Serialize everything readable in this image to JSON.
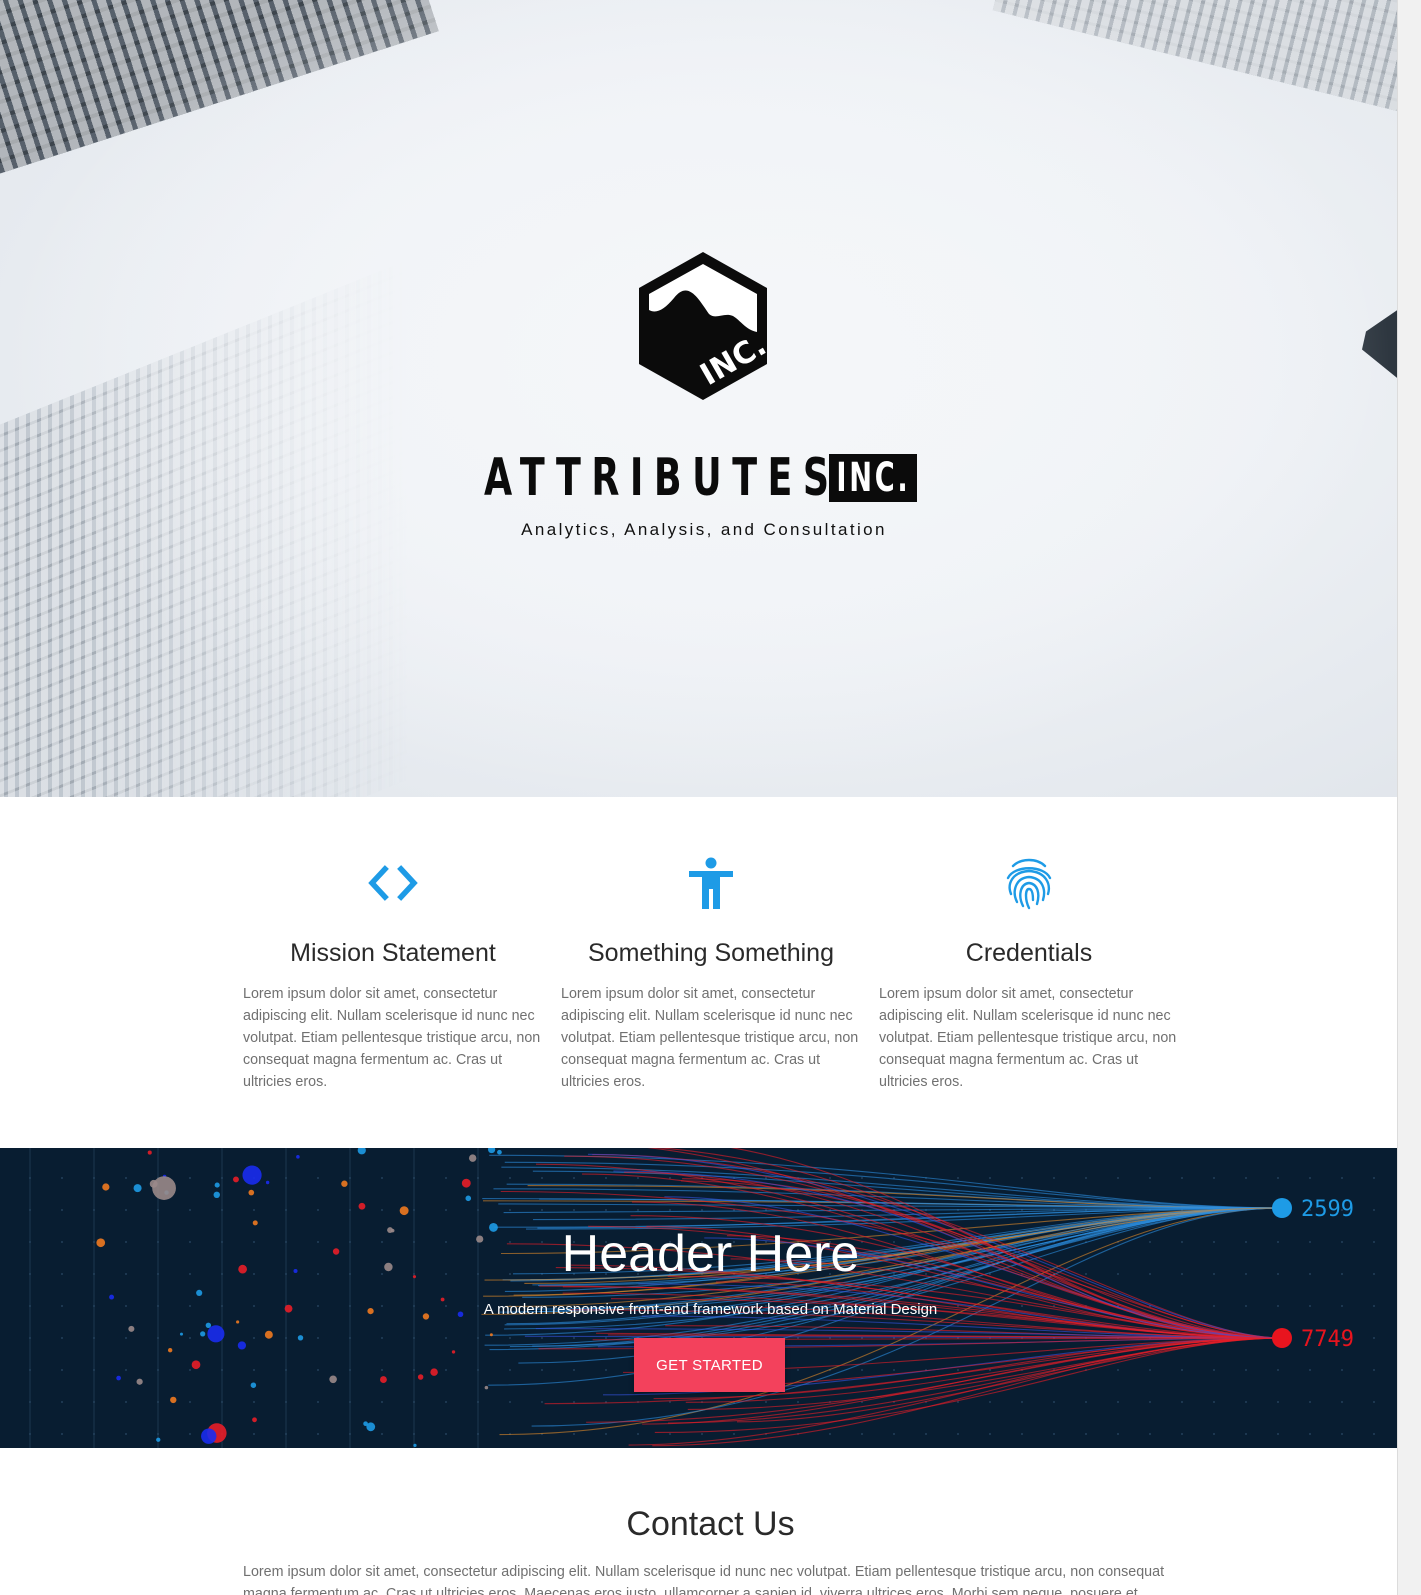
{
  "hero": {
    "brand_name": "ATTRIBUTES",
    "brand_suffix": "INC.",
    "logo_badge_text": "INC.",
    "tagline": "Analytics, Analysis, and Consultation"
  },
  "features": [
    {
      "icon": "code-brackets-icon",
      "title": "Mission Statement",
      "text": "Lorem ipsum dolor sit amet, consectetur adipiscing elit. Nullam scelerisque id nunc nec volutpat. Etiam pellentesque tristique arcu, non consequat magna fermentum ac. Cras ut ultricies eros."
    },
    {
      "icon": "accessibility-person-icon",
      "title": "Something Something",
      "text": "Lorem ipsum dolor sit amet, consectetur adipiscing elit. Nullam scelerisque id nunc nec volutpat. Etiam pellentesque tristique arcu, non consequat magna fermentum ac. Cras ut ultricies eros."
    },
    {
      "icon": "fingerprint-icon",
      "title": "Credentials",
      "text": "Lorem ipsum dolor sit amet, consectetur adipiscing elit. Nullam scelerisque id nunc nec volutpat. Etiam pellentesque tristique arcu, non consequat magna fermentum ac. Cras ut ultricies eros."
    }
  ],
  "banner": {
    "title": "Header Here",
    "subtitle": "A modern responsive front-end framework based on Material Design",
    "cta_label": "GET STARTED",
    "stat_blue": "2599",
    "stat_red": "7749"
  },
  "contact": {
    "title": "Contact Us",
    "text": "Lorem ipsum dolor sit amet, consectetur adipiscing elit. Nullam scelerisque id nunc nec volutpat. Etiam pellentesque tristique arcu, non consequat magna fermentum ac. Cras ut ultricies eros. Maecenas eros justo, ullamcorper a sapien id, viverra ultrices eros. Morbi sem neque, posuere et pretium"
  },
  "colors": {
    "accent_blue": "#1e9be6",
    "cta_red": "#f3415c",
    "banner_bg": "#081d31",
    "flow_blue": "#1e8fe0",
    "flow_red": "#e8141e"
  }
}
